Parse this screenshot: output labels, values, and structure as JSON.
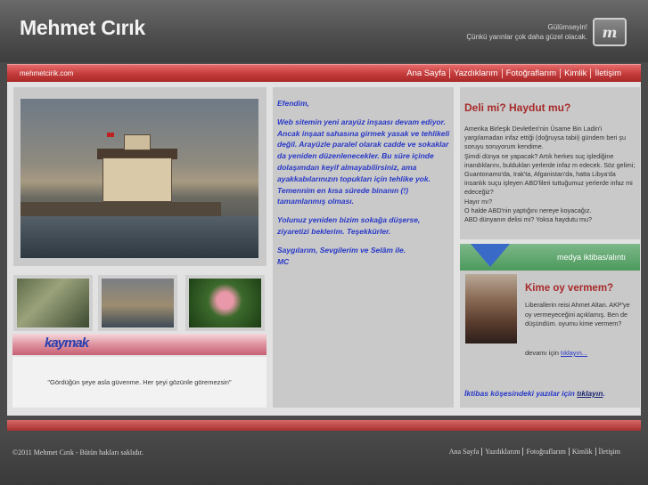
{
  "header": {
    "title": "Mehmet Cırık",
    "tagline_line1": "Gülümseyin!",
    "tagline_line2": "Çünkü yarınlar çok daha güzel olacak.",
    "logo_glyph": "m"
  },
  "navbar": {
    "url": "mehmetcirik.com",
    "links": [
      "Ana Sayfa",
      "Yazdıklarım",
      "Fotoğraflarım",
      "Kimlik",
      "İletişim"
    ]
  },
  "left": {
    "kaymak_logo": "kaymak",
    "quote": "\"Gördüğün şeye asla güvenme. Her şeyi gözünle göremezsin\""
  },
  "middle": {
    "greeting": "Efendim,",
    "para1": "Web sitemin yeni arayüz inşaası devam ediyor. Ancak inşaat sahasına girmek yasak ve tehlikeli değil. Arayüzle paralel olarak cadde ve sokaklar da yeniden düzenlenecekler. Bu süre içinde dolaşımdan keyif almayabilirsiniz, ama ayakkabılarınızın topukları için tehlike yok. Temennim en kısa sürede binanın (!) tamamlanmış olması.",
    "para2": "Yolunuz yeniden bizim sokağa düşerse, ziyaretizi beklerim. Teşekkürler.",
    "signoff": "Saygılarım, Sevgilerim ve Selâm ile.",
    "initials": "MC"
  },
  "right_top": {
    "title": "Deli mi? Haydut mu?",
    "lines": [
      "Amerika Birleşik Devletleri'nin Üsame Bin Ladin'i yargılamadan infaz ettiği (doğruysa tabii) gündem beri şu soruyu soruyorum kendime.",
      "Şimdi dünya ne yapacak? Artık herkes suç işlediğine inandıklarını, bulduklan yerlerde infaz m edecek. Söz gelimi; Guantonamo'da, Irak'ta, Afganistan'da, hatta Libya'da insanlık suçu işleyen ABD'lileri tuttuğumuz yerlerde infaz mi edeceğiz?",
      "Hayır mı?",
      "O halde ABD'nin yaptığını nereye koyacağız.",
      "ABD dünyanın delisi mi? Yoksa haydutu mu?"
    ]
  },
  "medya": {
    "label": "medya iktibas/alıntı"
  },
  "right_bottom": {
    "title": "Kime oy vermem?",
    "text": "Liberallerin reisi Ahmet Altan. AKP'ye oy vermeyeceğini açıklamış. Ben de düşündüm. oyumu kime vermem?",
    "more_prefix": "devamı için",
    "more_link": "tıklayın...",
    "footer_prefix": "İktibas köşesindeki yazılar için",
    "footer_link": "tıklayın",
    "footer_suffix": "."
  },
  "footer": {
    "copyright": "©2011 Mehmet Cırık - Bütün hakları saklıdır.",
    "links": [
      "Ana Sayfa",
      "Yazdıklarım",
      "Fotoğraflarım",
      "Kimlik",
      "İletişim"
    ]
  }
}
